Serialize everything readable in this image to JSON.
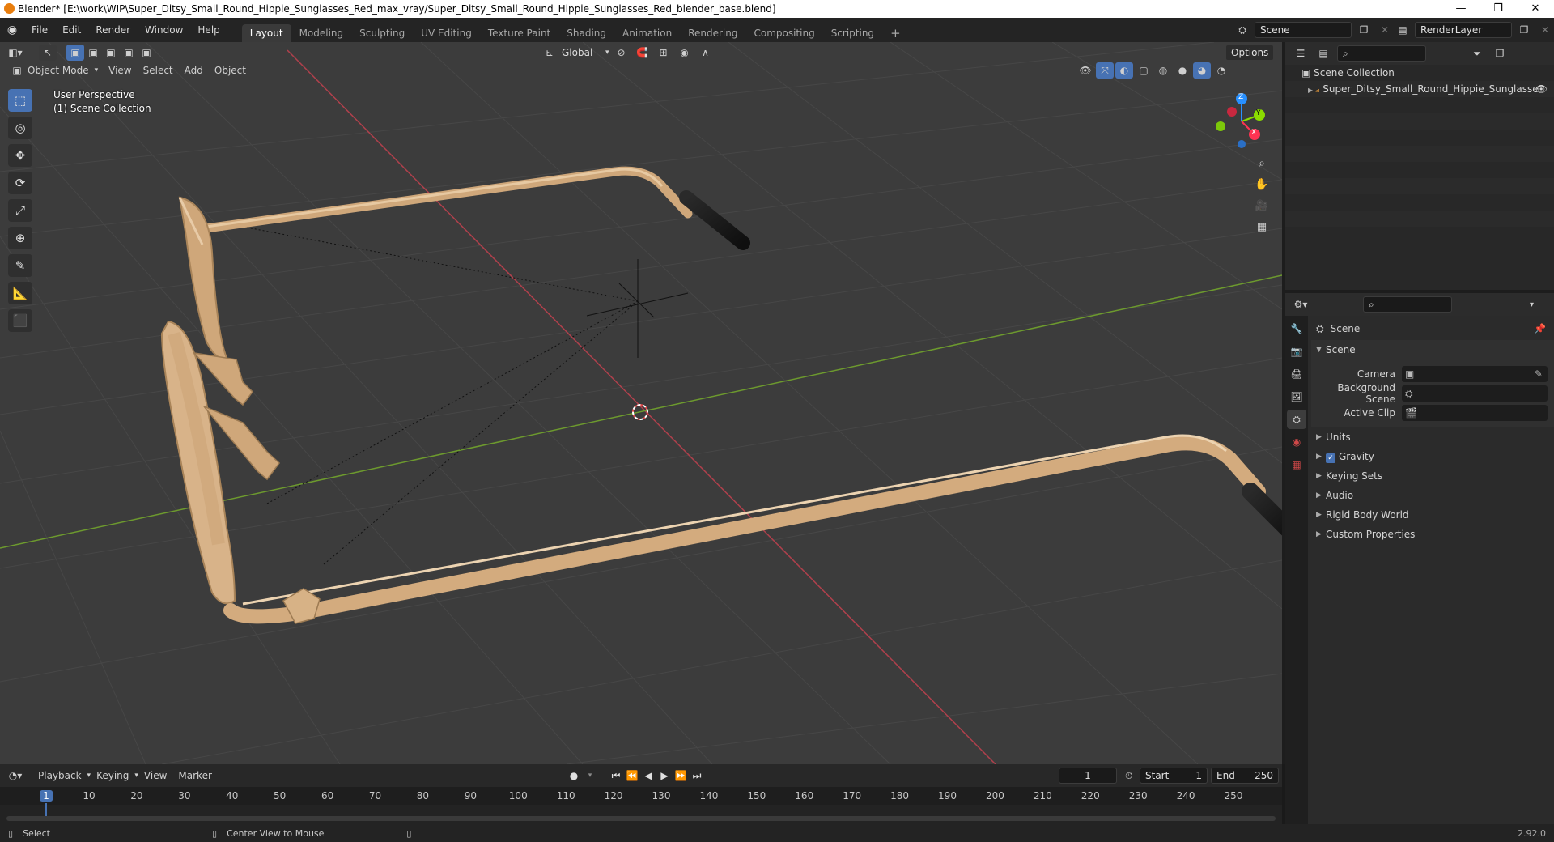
{
  "window": {
    "title": "Blender* [E:\\work\\WIP\\Super_Ditsy_Small_Round_Hippie_Sunglasses_Red_max_vray/Super_Ditsy_Small_Round_Hippie_Sunglasses_Red_blender_base.blend]",
    "minimize": "—",
    "maximize": "❐",
    "close": "✕"
  },
  "menu": [
    "File",
    "Edit",
    "Render",
    "Window",
    "Help"
  ],
  "workspaces": [
    "Layout",
    "Modeling",
    "Sculpting",
    "UV Editing",
    "Texture Paint",
    "Shading",
    "Animation",
    "Rendering",
    "Compositing",
    "Scripting"
  ],
  "workspace_add": "+",
  "scene_field": "Scene",
  "renderlayer_field": "RenderLayer",
  "viewport": {
    "transform_orientation": "Global",
    "options_label": "Options",
    "mode": "Object Mode",
    "menu": [
      "View",
      "Select",
      "Add",
      "Object"
    ],
    "overlay_line1": "User Perspective",
    "overlay_line2": "(1) Scene Collection",
    "gizmo": {
      "z": "Z",
      "y": "Y",
      "x": "X"
    }
  },
  "outliner": {
    "root": "Scene Collection",
    "items": [
      "Super_Ditsy_Small_Round_Hippie_Sunglasse"
    ]
  },
  "properties": {
    "context": "Scene",
    "panel": "Scene",
    "fields": [
      {
        "label": "Camera",
        "value": ""
      },
      {
        "label": "Background Scene",
        "value": ""
      },
      {
        "label": "Active Clip",
        "value": ""
      }
    ],
    "subpanels": [
      {
        "label": "Units",
        "checkbox": false
      },
      {
        "label": "Gravity",
        "checkbox": true
      },
      {
        "label": "Keying Sets",
        "checkbox": false
      },
      {
        "label": "Audio",
        "checkbox": false
      },
      {
        "label": "Rigid Body World",
        "checkbox": false
      },
      {
        "label": "Custom Properties",
        "checkbox": false
      }
    ]
  },
  "timeline": {
    "menu": [
      "Playback",
      "Keying",
      "View",
      "Marker"
    ],
    "current_frame": "1",
    "start_label": "Start",
    "start": "1",
    "end_label": "End",
    "end": "250",
    "ticks": [
      "1",
      "10",
      "20",
      "30",
      "40",
      "50",
      "60",
      "70",
      "80",
      "90",
      "100",
      "110",
      "120",
      "130",
      "140",
      "150",
      "160",
      "170",
      "180",
      "190",
      "200",
      "210",
      "220",
      "230",
      "240",
      "250"
    ]
  },
  "status": {
    "left": "Select",
    "middle": "Center View to Mouse",
    "version": "2.92.0"
  },
  "colors": {
    "accent": "#4772b3",
    "x_axis": "#ff3352",
    "y_axis": "#8bdc00",
    "z_axis": "#2890ff",
    "frame_color": "#d9b48a"
  }
}
